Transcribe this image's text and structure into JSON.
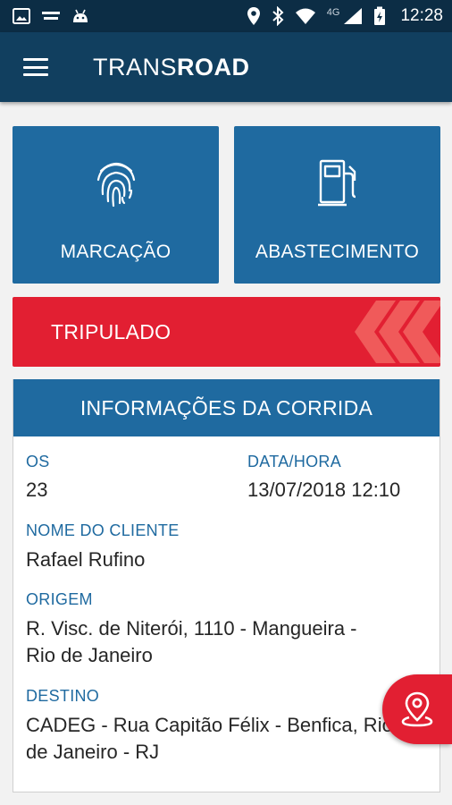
{
  "status_bar": {
    "time": "12:28",
    "network": "4G",
    "icons": [
      "image-icon",
      "transroad-notification-icon",
      "android-icon",
      "location-icon",
      "bluetooth-icon",
      "wifi-icon",
      "signal-icon",
      "battery-charging-icon"
    ]
  },
  "app_bar": {
    "logo_light": "TRANS",
    "logo_bold": "ROAD",
    "menu_icon": "hamburger-menu-icon"
  },
  "tiles": {
    "marcacao": {
      "label": "MARCAÇÃO",
      "icon": "fingerprint-icon"
    },
    "abastecimento": {
      "label": "ABASTECIMENTO",
      "icon": "fuel-pump-icon"
    }
  },
  "banner": {
    "label": "TRIPULADO",
    "icon": "chevrons-left-icon"
  },
  "trip_info": {
    "title": "INFORMAÇÕES DA CORRIDA",
    "os_label": "OS",
    "os_value": "23",
    "datetime_label": "DATA/HORA",
    "datetime_value": "13/07/2018 12:10",
    "client_label": "NOME DO CLIENTE",
    "client_value": "Rafael Rufino",
    "origin_label": "ORIGEM",
    "origin_line1": "R. Visc. de Niterói, 1110 - Mangueira -",
    "origin_line2": "Rio de Janeiro",
    "destination_label": "DESTINO",
    "destination_line1": "CADEG - Rua Capitão Félix - Benfica, Rio",
    "destination_line2": "de Janeiro - RJ"
  },
  "fab": {
    "icon": "map-pin-icon"
  },
  "colors": {
    "status_bar": "#0c2d45",
    "app_bar": "#113f5f",
    "primary_blue": "#1f6aa0",
    "accent_red": "#e21f32",
    "text_dark": "#262626"
  }
}
